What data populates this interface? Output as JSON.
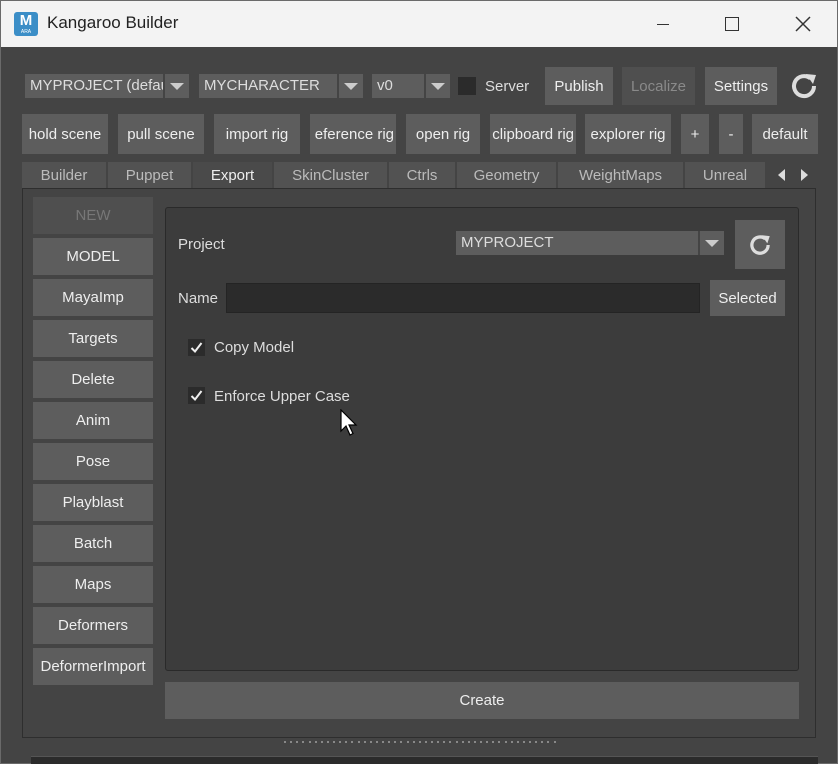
{
  "window": {
    "title": "Kangaroo Builder",
    "icon_letter": "M",
    "icon_sub": "ARA",
    "controls": [
      "minimize-icon",
      "maximize-icon",
      "close-icon"
    ]
  },
  "toolbar": {
    "project_combo": "MYPROJECT (defau",
    "character_combo": "MYCHARACTER",
    "version_combo": "v0",
    "server_label": "Server",
    "server_checked": false,
    "publish_label": "Publish",
    "localize_label": "Localize",
    "settings_label": "Settings",
    "refresh_icon": "refresh-icon"
  },
  "actions": {
    "hold_scene": "hold scene",
    "pull_scene": "pull scene",
    "import_rig": "import rig",
    "reference_rig": "eference rig",
    "open_rig": "open rig",
    "clipboard_rig": "clipboard rig",
    "explorer_rig": "explorer rig",
    "plus": "+",
    "minus": "-",
    "default": "default"
  },
  "tabs": [
    "Builder",
    "Puppet",
    "Export",
    "SkinCluster",
    "Ctrls",
    "Geometry",
    "WeightMaps",
    "Unreal"
  ],
  "active_tab": "Export",
  "sidebar": {
    "items": [
      "NEW",
      "MODEL",
      "MayaImp",
      "Targets",
      "Delete",
      "Anim",
      "Pose",
      "Playblast",
      "Batch",
      "Maps",
      "Deformers",
      "DeformerImport"
    ]
  },
  "panel": {
    "project_label": "Project",
    "project_value": "MYPROJECT",
    "name_label": "Name",
    "name_value": "",
    "selected_label": "Selected",
    "copy_model_label": "Copy Model",
    "copy_model_checked": true,
    "enforce_upper_label": "Enforce Upper Case",
    "enforce_upper_checked": true
  },
  "create_label": "Create",
  "colors": {
    "background": "#444444",
    "button": "#5d5d5d",
    "field": "#2b2b2b",
    "panel": "#3c3c3c",
    "titlebar": "#f3f3f3",
    "icon_blue": "#3b8ec7"
  }
}
